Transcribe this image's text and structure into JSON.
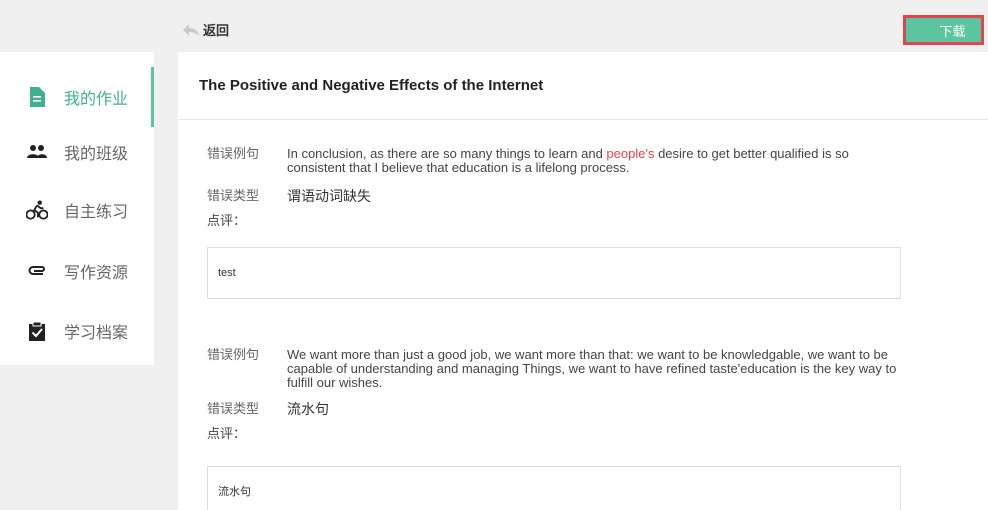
{
  "header": {
    "back_label": "返回",
    "download_label": "下载"
  },
  "sidebar": {
    "items": [
      {
        "label": "我的作业",
        "icon": "document-icon",
        "active": true
      },
      {
        "label": "我的班级",
        "icon": "users-icon",
        "active": false
      },
      {
        "label": "自主练习",
        "icon": "bicycle-icon",
        "active": false
      },
      {
        "label": "写作资源",
        "icon": "paperclip-icon",
        "active": false
      },
      {
        "label": "学习档案",
        "icon": "clipboard-check-icon",
        "active": false
      }
    ]
  },
  "main": {
    "title": "The Positive and Negative Effects of the Internet",
    "labels": {
      "example": "错误例句",
      "type": "错误类型",
      "comment": "点评："
    },
    "errors": [
      {
        "sentence_before": "In conclusion, as there are so many things to learn and ",
        "sentence_highlight": "people's",
        "sentence_after": " desire to get better qualified is so consistent that I believe that education is a lifelong process.",
        "type": "谓语动词缺失",
        "comment": "test"
      },
      {
        "sentence_highlight": "We want more than just a good job, we want more than that: we want to be knowledgable, we want to be capable of understanding and managing Things, we want to have refined taste'education is the key way to fulfill our wishes.",
        "type": "流水句",
        "comment": "流水句"
      }
    ]
  },
  "colors": {
    "accent": "#5bc5a1",
    "error_red": "#e0474c",
    "highlight_border": "#e0474c"
  }
}
